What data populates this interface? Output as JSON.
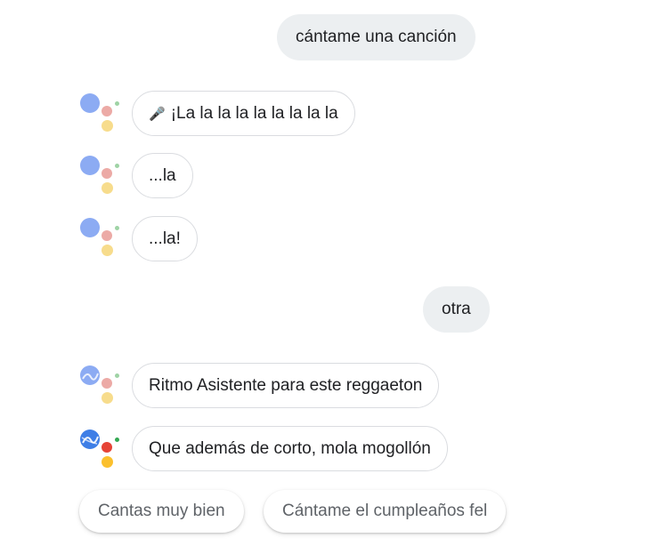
{
  "conversation": {
    "user_1": "cántame una canción",
    "assistant_1_icon": "microphone-icon",
    "assistant_1": "¡La la la la la la la la la",
    "assistant_2": "...la",
    "assistant_3": "...la!",
    "user_2": "otra",
    "assistant_4": "Ritmo Asistente para este reggaeton",
    "assistant_5": "Que además de corto, mola mogollón"
  },
  "suggestions": [
    "Cantas muy bien",
    "Cántame el cumpleaños fel"
  ],
  "colors": {
    "user_bubble": "#eceff1",
    "assistant_border": "#dadce0",
    "logo_blue": "#3e7ee6",
    "logo_red": "#e64336",
    "logo_green": "#34a853",
    "logo_yellow": "#fbc02d"
  }
}
